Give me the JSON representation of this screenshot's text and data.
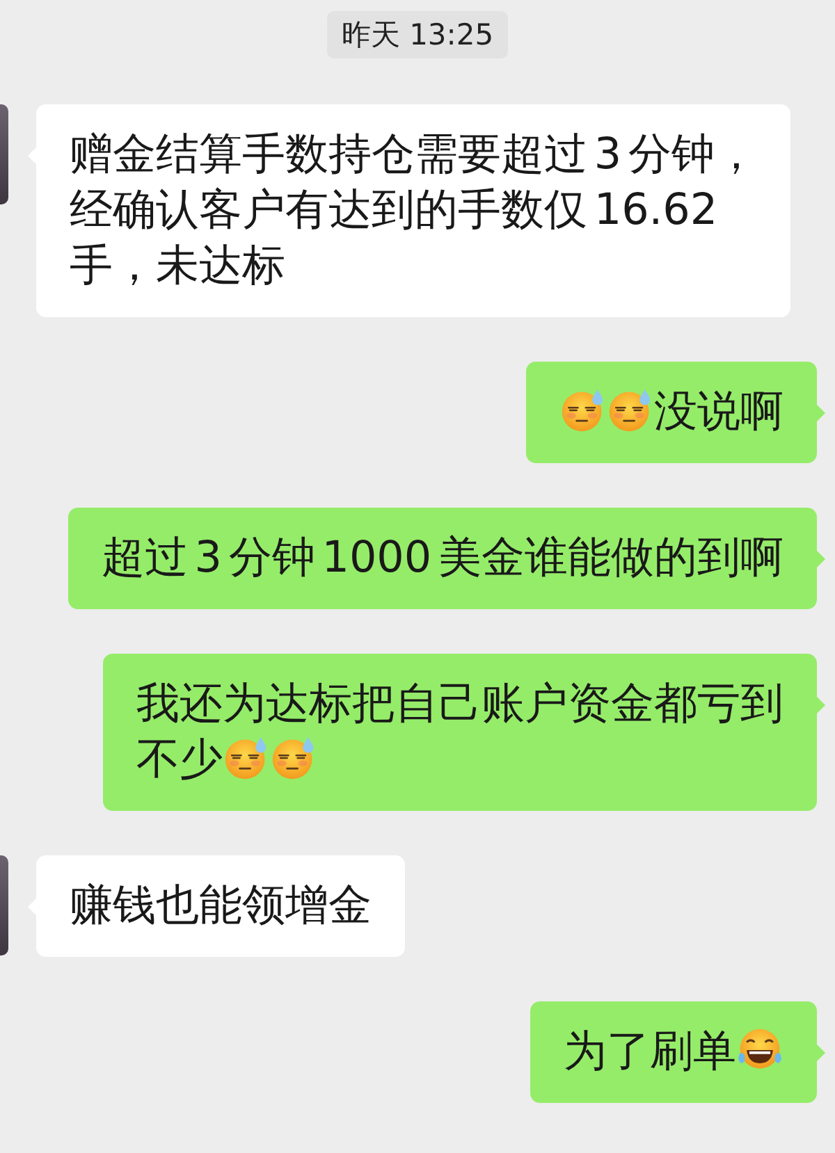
{
  "timestamp": "昨天 13:25",
  "messages": [
    {
      "kind": "incoming",
      "parts": [
        {
          "kind": "line",
          "text": "赠金结算手数持仓需要超过 3 分钟，"
        },
        {
          "kind": "line",
          "text": "经确认客户有达到的手数仅 16.62"
        },
        {
          "kind": "line",
          "text": "手，未达标"
        }
      ]
    },
    {
      "kind": "outgoing",
      "parts": [
        {
          "kind": "sweat"
        },
        {
          "kind": "sweat"
        },
        {
          "kind": "text",
          "text": "没说啊"
        }
      ]
    },
    {
      "kind": "outgoing",
      "parts": [
        {
          "kind": "text",
          "text": "超过 3 分钟 1000 美金谁能做的到啊"
        }
      ]
    },
    {
      "kind": "outgoing",
      "parts": [
        {
          "kind": "line",
          "text": "我还为达标把自己账户资金都亏到"
        },
        {
          "kind": "text",
          "text": "不少"
        },
        {
          "kind": "sweat"
        },
        {
          "kind": "sweat"
        }
      ]
    },
    {
      "kind": "incoming",
      "parts": [
        {
          "kind": "text",
          "text": "赚钱也能领增金"
        }
      ]
    },
    {
      "kind": "outgoing",
      "parts": [
        {
          "kind": "text",
          "text": "为了刷单"
        },
        {
          "kind": "laugh"
        }
      ]
    }
  ]
}
